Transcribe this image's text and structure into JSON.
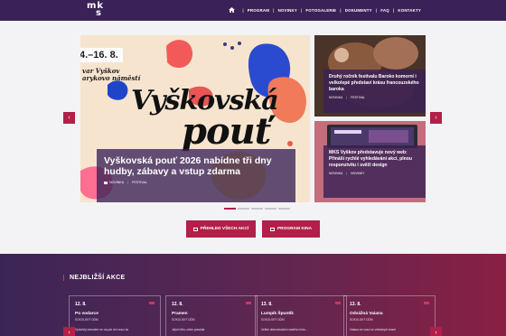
{
  "header": {
    "logo_line1": "mk",
    "logo_line2": "s",
    "nav": [
      "PROGRAM",
      "NOVINKY",
      "FOTOGALERIE",
      "DOKUMENTY",
      "FAQ",
      "KONTAKTY"
    ]
  },
  "hero": {
    "date": "4.–16. 8.",
    "venue_line1": "var Vyškov",
    "venue_line2": "arykovo náměstí",
    "art_word1": "Vyškovská",
    "art_word2": "pouť",
    "title": "Vyškovská pouť 2026 nabídne tři dny hudby, zábavy a vstup zdarma",
    "tags": [
      "NOVINKA",
      "FESTIVAL"
    ]
  },
  "side_cards": [
    {
      "title": "Druhý ročník festivalu Baroko komorní i velkolepé představí krásu francouzského baroka",
      "tags": [
        "NOVINKA",
        "FESTIVAL"
      ]
    },
    {
      "title": "MKS Vyškov představuje nový web: Přináší rychlé vyhledávání akcí, plnou responzivitu i svěží design",
      "tags": [
        "NOVINKA",
        "NOVINKY"
      ]
    }
  ],
  "arrows": {
    "prev": "‹",
    "next": "›"
  },
  "buttons": {
    "all_events": "PŘEHLED VŠECH AKCÍ",
    "cinema": "PROGRAM KINA"
  },
  "events_section": {
    "heading": "NEJBLIŽŠÍ AKCE",
    "items": [
      {
        "date": "12. 8.",
        "name": "Po vodarce",
        "place": "SOKOLSKÝ DŮM",
        "desc": "Vyhořelý menažer se na pár dní vrací do"
      },
      {
        "date": "12. 8.",
        "name": "Pramen",
        "place": "SOKOLSKÝ DŮM",
        "desc": "Jejich tělo, nebe pravidla"
      },
      {
        "date": "13. 8.",
        "name": "Lumpík Špuntík",
        "place": "SOKOLSKÝ DŮM",
        "desc": "Veliké dobrodružství malého hrdo..."
      },
      {
        "date": "13. 8.",
        "name": "Odvážná Vaiana",
        "place": "SOKOLSKÝ DŮM",
        "desc": "Vaiana se vrací ve velkolepé hrané"
      }
    ]
  },
  "colors": {
    "header": "#3a2157",
    "accent": "#b21f48",
    "caption": "#3a2157"
  }
}
